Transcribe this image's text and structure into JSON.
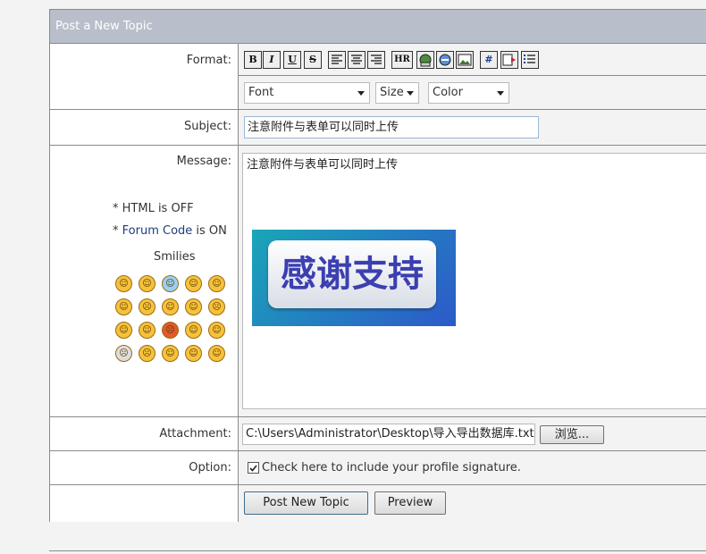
{
  "form": {
    "title": "Post a New Topic"
  },
  "labels": {
    "format": "Format:",
    "subject": "Subject:",
    "message": "Message:",
    "attachment": "Attachment:",
    "option": "Option:"
  },
  "toolbar": {
    "buttons": [
      {
        "label": "B",
        "icon": "bold-icon"
      },
      {
        "label": "I",
        "icon": "italic-icon"
      },
      {
        "label": "U",
        "icon": "underline-icon"
      },
      {
        "label": "S",
        "icon": "strikethrough-icon"
      },
      {
        "label": "",
        "icon": "align-left-icon"
      },
      {
        "label": "",
        "icon": "align-center-icon"
      },
      {
        "label": "",
        "icon": "align-right-icon"
      },
      {
        "label": "HR",
        "icon": "horizontal-rule-icon"
      },
      {
        "label": "",
        "icon": "email-link-icon"
      },
      {
        "label": "",
        "icon": "hyperlink-icon"
      },
      {
        "label": "",
        "icon": "image-icon"
      },
      {
        "label": "#",
        "icon": "code-icon"
      },
      {
        "label": "",
        "icon": "quote-icon"
      },
      {
        "label": "",
        "icon": "list-icon"
      }
    ]
  },
  "selects": {
    "font": "Font",
    "size": "Size",
    "color": "Color"
  },
  "subject": {
    "value": "注意附件与表单可以同时上传"
  },
  "message": {
    "value": "注意附件与表单可以同时上传",
    "image_text": "感谢支持"
  },
  "sidebar": {
    "html_prefix": "* HTML is OFF",
    "forum_prefix": "* ",
    "forum_link": "Forum Code",
    "forum_suffix": " is ON",
    "smilies_title": "Smilies"
  },
  "attachment": {
    "path": "C:\\Users\\Administrator\\Desktop\\导入导出数据库.txt",
    "browse_label": "浏览..."
  },
  "option": {
    "checkbox_label": "Check here to include your profile signature.",
    "checked": true
  },
  "actions": {
    "post_label": "Post New Topic",
    "preview_label": "Preview"
  },
  "colors": {
    "header": "#b8bfca",
    "border": "#8a8a8a",
    "link": "#1d3f7a"
  }
}
